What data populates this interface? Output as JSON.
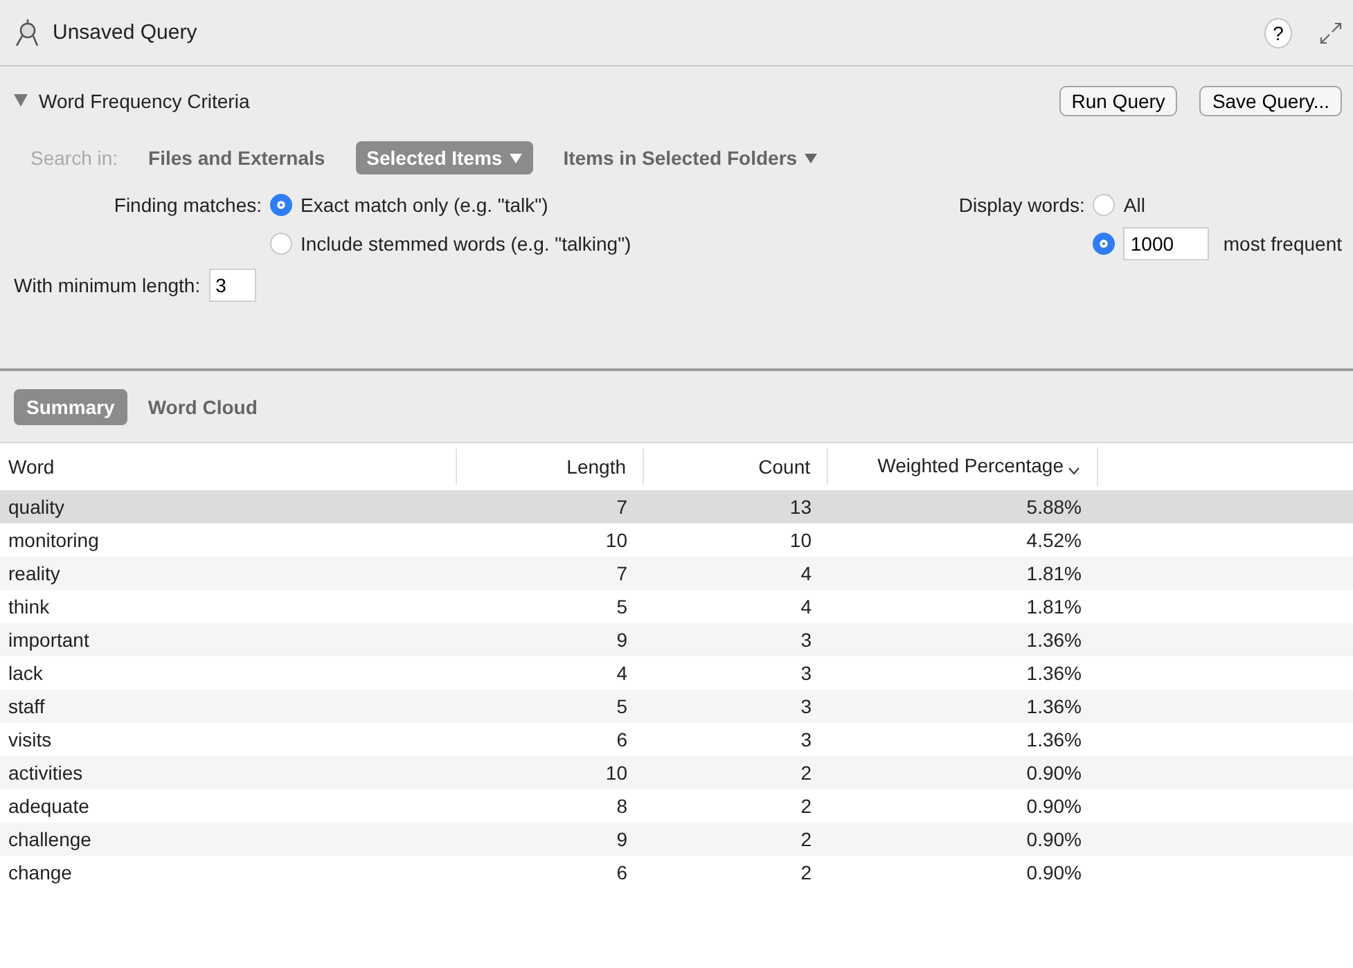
{
  "window": {
    "title": "Unsaved Query",
    "help": "?"
  },
  "criteria": {
    "title": "Word Frequency Criteria",
    "expanded": true,
    "buttons": [
      "Run Query",
      "Save Query..."
    ],
    "search_in": {
      "label": "Search in:",
      "options": [
        {
          "label": "Files and Externals",
          "selected": false,
          "dropdown": false
        },
        {
          "label": "Selected Items",
          "selected": true,
          "dropdown": true
        },
        {
          "label": "Items in Selected Folders",
          "selected": false,
          "dropdown": true
        }
      ]
    },
    "finding": {
      "label": "Finding matches:",
      "options": [
        {
          "label": "Exact match only (e.g. \"talk\")",
          "selected": true
        },
        {
          "label": "Include stemmed words (e.g. \"talking\")",
          "selected": false
        }
      ]
    },
    "display": {
      "label": "Display words:",
      "options": [
        {
          "kind": "plain",
          "label": "All",
          "selected": false
        },
        {
          "kind": "count",
          "value": "1000",
          "suffix": "most frequent",
          "selected": true
        }
      ]
    },
    "min_length": {
      "label": "With minimum length:",
      "value": "3"
    }
  },
  "tabs": [
    {
      "label": "Summary",
      "selected": true
    },
    {
      "label": "Word Cloud",
      "selected": false
    }
  ],
  "table": {
    "columns": [
      {
        "label": "Word",
        "sorted": false
      },
      {
        "label": "Length",
        "sorted": false
      },
      {
        "label": "Count",
        "sorted": false
      },
      {
        "label": "Weighted Percentage",
        "sorted": true
      }
    ],
    "rows": [
      {
        "cells": [
          "quality",
          "7",
          "13",
          "5.88%"
        ],
        "selected": true
      },
      {
        "cells": [
          "monitoring",
          "10",
          "10",
          "4.52%"
        ],
        "selected": false
      },
      {
        "cells": [
          "reality",
          "7",
          "4",
          "1.81%"
        ],
        "selected": false
      },
      {
        "cells": [
          "think",
          "5",
          "4",
          "1.81%"
        ],
        "selected": false
      },
      {
        "cells": [
          "important",
          "9",
          "3",
          "1.36%"
        ],
        "selected": false
      },
      {
        "cells": [
          "lack",
          "4",
          "3",
          "1.36%"
        ],
        "selected": false
      },
      {
        "cells": [
          "staff",
          "5",
          "3",
          "1.36%"
        ],
        "selected": false
      },
      {
        "cells": [
          "visits",
          "6",
          "3",
          "1.36%"
        ],
        "selected": false
      },
      {
        "cells": [
          "activities",
          "10",
          "2",
          "0.90%"
        ],
        "selected": false
      },
      {
        "cells": [
          "adequate",
          "8",
          "2",
          "0.90%"
        ],
        "selected": false
      },
      {
        "cells": [
          "challenge",
          "9",
          "2",
          "0.90%"
        ],
        "selected": false
      },
      {
        "cells": [
          "change",
          "6",
          "2",
          "0.90%"
        ],
        "selected": false
      }
    ]
  }
}
